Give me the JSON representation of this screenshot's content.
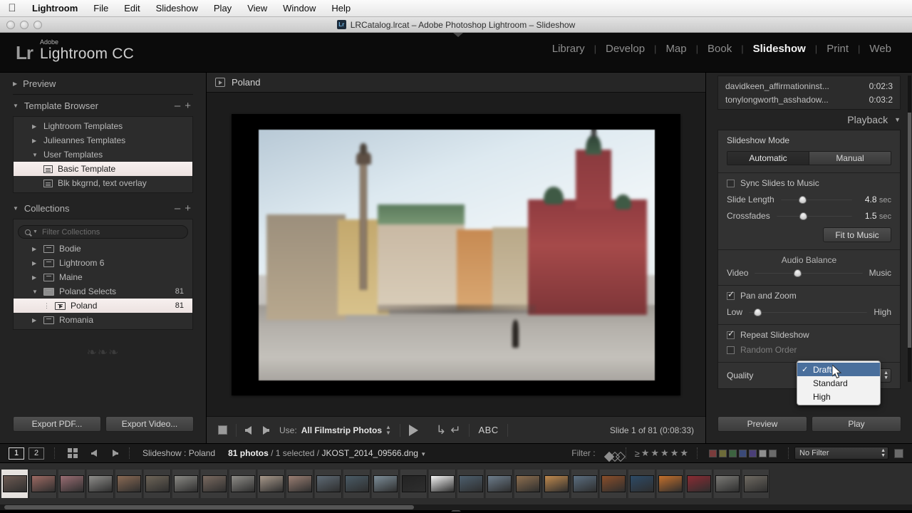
{
  "menubar": {
    "apple_icon": "apple-logo",
    "items": [
      "Lightroom",
      "File",
      "Edit",
      "Slideshow",
      "Play",
      "View",
      "Window",
      "Help"
    ]
  },
  "titlebar": {
    "title": "LRCatalog.lrcat – Adobe Photoshop Lightroom – Slideshow",
    "badge": "Lr"
  },
  "identity": {
    "mark": "Lr",
    "adobe": "Adobe",
    "product": "Lightroom CC"
  },
  "modules": {
    "items": [
      "Library",
      "Develop",
      "Map",
      "Book",
      "Slideshow",
      "Print",
      "Web"
    ],
    "active": "Slideshow"
  },
  "left_panel": {
    "preview": {
      "label": "Preview",
      "twisty": "collapsed"
    },
    "template_browser": {
      "label": "Template Browser",
      "minus": "–",
      "plus": "+",
      "items": [
        {
          "label": "Lightroom Templates",
          "level": 0,
          "twisty": "collapsed",
          "selected": false
        },
        {
          "label": "Julieannes Templates",
          "level": 0,
          "twisty": "collapsed",
          "selected": false
        },
        {
          "label": "User Templates",
          "level": 0,
          "twisty": "expanded",
          "selected": false
        },
        {
          "label": "Basic Template",
          "level": 1,
          "twisty": "none",
          "selected": true
        },
        {
          "label": "Blk bkgrnd, text overlay",
          "level": 1,
          "twisty": "none",
          "selected": false
        }
      ]
    },
    "collections": {
      "label": "Collections",
      "minus": "–",
      "plus": "+",
      "filter_placeholder": "Filter Collections",
      "items": [
        {
          "label": "Bodie",
          "count": "",
          "level": 0,
          "twisty": "collapsed",
          "selected": false,
          "icon": "collection-set-icon"
        },
        {
          "label": "Lightroom 6",
          "count": "",
          "level": 0,
          "twisty": "collapsed",
          "selected": false,
          "icon": "collection-set-icon"
        },
        {
          "label": "Maine",
          "count": "",
          "level": 0,
          "twisty": "collapsed",
          "selected": false,
          "icon": "collection-set-icon"
        },
        {
          "label": "Poland Selects",
          "count": "81",
          "level": 0,
          "twisty": "expanded",
          "selected": false,
          "icon": "collection-set-filled-icon"
        },
        {
          "label": "Poland",
          "count": "81",
          "level": 1,
          "twisty": "none",
          "selected": true,
          "icon": "slideshow-collection-icon"
        },
        {
          "label": "Romania",
          "count": "",
          "level": 0,
          "twisty": "collapsed",
          "selected": false,
          "icon": "collection-set-icon"
        }
      ]
    },
    "export_pdf_label": "Export PDF...",
    "export_video_label": "Export Video..."
  },
  "center": {
    "header_title": "Poland",
    "header_icon": "slideshow-collection-icon",
    "toolbar": {
      "stop_icon": "stop-button",
      "prev_icon": "previous-slide-arrow",
      "next_icon": "next-slide-arrow",
      "use_label": "Use:",
      "use_value": "All Filmstrip Photos",
      "play_icon": "play-button",
      "rotate_left_icon": "rotate-left-arrow",
      "rotate_right_icon": "rotate-right-arrow",
      "abc_label": "ABC",
      "slide_status": "Slide 1 of 81 (0:08:33)"
    }
  },
  "right_panel": {
    "music": [
      {
        "name": "davidkeen_affirmationinst...",
        "time": "0:02:3"
      },
      {
        "name": "tonylongworth_asshadow...",
        "time": "0:03:2"
      }
    ],
    "playback": {
      "label": "Playback",
      "twisty": "▼",
      "slideshow_mode_label": "Slideshow Mode",
      "mode_options": [
        "Automatic",
        "Manual"
      ],
      "mode_active": "Automatic",
      "sync_slides_label": "Sync Slides to Music",
      "sync_slides_checked": false,
      "slide_length_label": "Slide Length",
      "slide_length_value": "4.8",
      "slide_length_unit": "sec",
      "slide_length_pct": 25,
      "crossfades_label": "Crossfades",
      "crossfades_value": "1.5",
      "crossfades_unit": "sec",
      "crossfades_pct": 30,
      "fit_to_music_label": "Fit to Music",
      "audio_balance_label": "Audio Balance",
      "audio_video_label": "Video",
      "audio_music_label": "Music",
      "audio_balance_pct": 36,
      "pan_and_zoom_label": "Pan and Zoom",
      "pan_and_zoom_checked": true,
      "pan_low_label": "Low",
      "pan_high_label": "High",
      "pan_zoom_pct": 4,
      "repeat_label": "Repeat Slideshow",
      "repeat_checked": true,
      "random_label": "Random Order",
      "random_checked": false,
      "quality_label": "Quality",
      "quality_value": "Draft",
      "quality_options": [
        {
          "label": "Draft",
          "checked": true,
          "highlighted": true
        },
        {
          "label": "Standard",
          "checked": false,
          "highlighted": false
        },
        {
          "label": "High",
          "checked": false,
          "highlighted": false
        }
      ],
      "check_glyph": "✓"
    },
    "preview_button": "Preview",
    "play_button": "Play"
  },
  "statusbar": {
    "page_1": "1",
    "page_2": "2",
    "grid_icon": "grid-view-icon",
    "back_icon": "navigate-back-arrow",
    "forward_icon": "navigate-forward-arrow",
    "source": "Slideshow : Poland",
    "photo_count": "81 photos",
    "selected_text": "/ 1 selected /",
    "filename": "JKOST_2014_09566.dng",
    "filter_label": "Filter :",
    "flags": [
      "flag-picked",
      "flag-unflagged",
      "flag-rejected"
    ],
    "stars_prefix": "≥",
    "star_count": 5,
    "color_swatches": [
      "#7a3c3c",
      "#6d6b39",
      "#3d6340",
      "#3b4a78",
      "#4a3f78",
      "#8e8e8e",
      "#6b6b6b"
    ],
    "no_filter_label": "No Filter",
    "collapse_icon": "filmstrip-collapse-icon"
  },
  "filmstrip": {
    "selected_index": 0,
    "thumbs": [
      "#6d5a52",
      "#9d6a63",
      "#9a6d73",
      "#8f8e8b",
      "#8a6a54",
      "#6e6558",
      "#8b8a85",
      "#7a6a60",
      "#8f8d88",
      "#a8998b",
      "#9b7f73",
      "#5e6a75",
      "#4a5b66",
      "#7d8e99",
      "#232323",
      "#f4f4f4",
      "#4d5f6e",
      "#6d7d8c",
      "#8e6f4f",
      "#c08a4e",
      "#5b6e80",
      "#8a4e2a",
      "#2d4a66",
      "#c4702c",
      "#8a2b33",
      "#7b7a76",
      "#6f6a62"
    ]
  },
  "colors": {
    "panel_bg": "#232323",
    "center_bg": "#1c1c1c",
    "accent_selection": "#4a6f9c",
    "slide_mat": "#b6b3b3"
  }
}
